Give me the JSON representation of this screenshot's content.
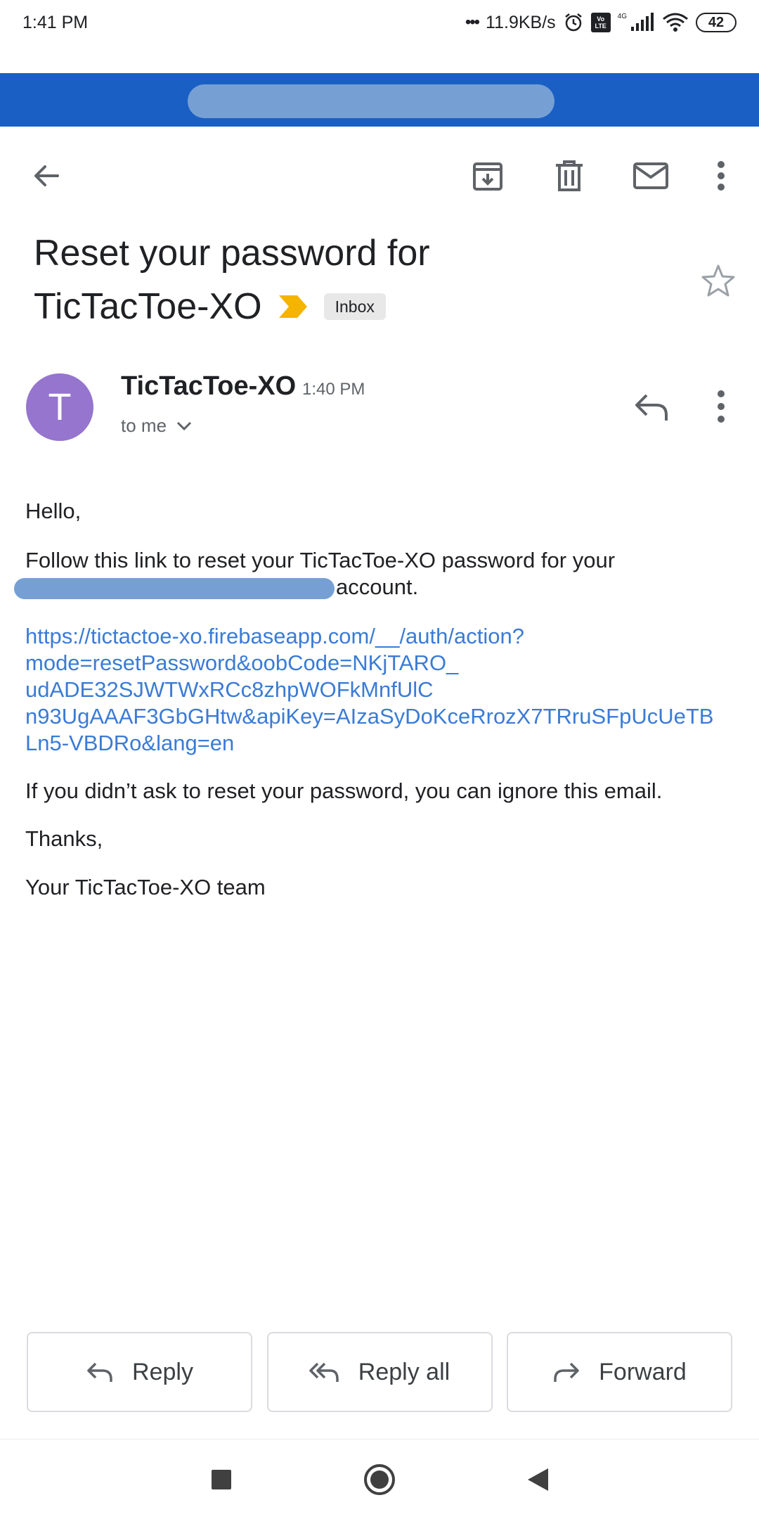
{
  "status_bar": {
    "time": "1:41 PM",
    "dots": "•••",
    "net_speed": "11.9KB/s",
    "volte_label": "Vo LTE",
    "network_label": "4G",
    "battery": "42"
  },
  "toolbar": {
    "back_icon": "arrow-back-icon",
    "archive_icon": "archive-icon",
    "delete_icon": "trash-icon",
    "mark_unread_icon": "mail-icon",
    "more_icon": "more-vert-icon"
  },
  "email": {
    "subject_line1": "Reset your password for",
    "subject_line2": "TicTacToe-XO",
    "label_chip": "Inbox",
    "important_color": "#f4b400",
    "sender_initial": "T",
    "avatar_color": "#9575cd",
    "sender_name": "TicTacToe-XO",
    "sent_time": "1:40 PM",
    "recipient": "to me",
    "greeting": "Hello,",
    "paragraph1_before": "Follow this link to reset your TicTacToe-XO password for your",
    "paragraph1_after": "account.",
    "reset_link": "https://tictactoe-xo.firebaseapp.com/__/auth/action?mode=resetPassword&oobCode=NKjTARO_udADE32SJWTWxRCc8zhpWOFkMnfUlCn93UgAAAF3GbGHtw&apiKey=AIzaSyDoKceRrozX7TRruSFpUcUeTBLn5-VBDRo&lang=en",
    "reset_link_lines": [
      "https://tictactoe-xo.firebaseapp.com/__/auth/action?",
      "mode=resetPassword&oobCode=NKjTARO_",
      "udADE32SJWTWxRCc8zhpWOFkMnfUlC",
      "n93UgAAAF3GbGHtw&apiKey=AIzaSyDoKceRrozX7TRruSFpUcUeTB",
      "Ln5-VBDRo&lang=en"
    ],
    "paragraph2": "If you didn’t ask to reset your password, you can ignore this email.",
    "thanks": "Thanks,",
    "signature": "Your TicTacToe-XO team",
    "link_color": "#3b7bd5"
  },
  "actions": {
    "reply": "Reply",
    "reply_all": "Reply all",
    "forward": "Forward"
  },
  "nav": {
    "recents_icon": "square-icon",
    "home_icon": "circle-icon",
    "back_icon": "triangle-back-icon"
  },
  "colors": {
    "header_blue": "#1a5fc4",
    "redaction": "#76a0d4"
  }
}
